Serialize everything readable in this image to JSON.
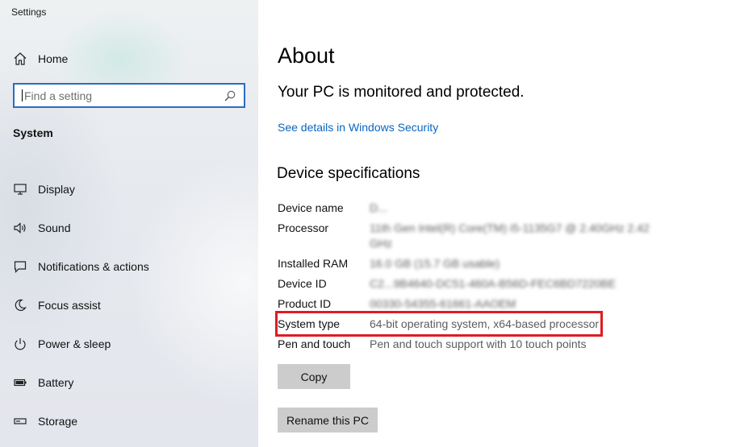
{
  "window": {
    "title": "Settings"
  },
  "sidebar": {
    "home_label": "Home",
    "search_placeholder": "Find a setting",
    "section_label": "System",
    "items": [
      {
        "label": "Display",
        "icon": "display-icon"
      },
      {
        "label": "Sound",
        "icon": "sound-icon"
      },
      {
        "label": "Notifications & actions",
        "icon": "notifications-icon"
      },
      {
        "label": "Focus assist",
        "icon": "focus-assist-icon"
      },
      {
        "label": "Power & sleep",
        "icon": "power-icon"
      },
      {
        "label": "Battery",
        "icon": "battery-icon"
      },
      {
        "label": "Storage",
        "icon": "storage-icon"
      }
    ]
  },
  "main": {
    "title": "About",
    "protection_heading": "Your PC is monitored and protected.",
    "security_link": "See details in Windows Security",
    "specs_heading": "Device specifications",
    "specs": [
      {
        "key": "Device name",
        "value": "D..."
      },
      {
        "key": "Processor",
        "value": "11th Gen Intel(R) Core(TM) i5-1135G7 @ 2.40GHz 2.42 GHz"
      },
      {
        "key": "Installed RAM",
        "value": "16.0 GB (15.7 GB usable)"
      },
      {
        "key": "Device ID",
        "value": "C2...9B4640-DC51-460A-B56D-FEC6BD7220BE"
      },
      {
        "key": "Product ID",
        "value": "00330-54355-61661-AAOEM"
      },
      {
        "key": "System type",
        "value": "64-bit operating system, x64-based processor"
      },
      {
        "key": "Pen and touch",
        "value": "Pen and touch support with 10 touch points"
      }
    ],
    "copy_button": "Copy",
    "rename_button": "Rename this PC"
  },
  "colors": {
    "accent": "#0a66c2",
    "search_border": "#2b6cc4",
    "highlight": "#e01b23",
    "button_bg": "#cccccc"
  }
}
